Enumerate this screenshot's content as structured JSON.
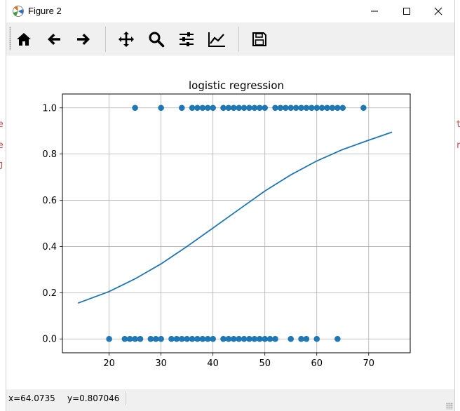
{
  "window": {
    "title": "Figure 2",
    "minimize_icon": "minimize-icon",
    "maximize_icon": "maximize-icon",
    "close_icon": "close-icon"
  },
  "toolbar": {
    "buttons": [
      {
        "name": "home-button",
        "icon": "home-icon"
      },
      {
        "name": "back-button",
        "icon": "arrow-left-icon"
      },
      {
        "name": "forward-button",
        "icon": "arrow-right-icon"
      },
      {
        "name": "pan-button",
        "icon": "move-icon"
      },
      {
        "name": "zoom-button",
        "icon": "magnifier-icon"
      },
      {
        "name": "subplots-button",
        "icon": "sliders-icon"
      },
      {
        "name": "edit-axes-button",
        "icon": "line-chart-icon"
      },
      {
        "name": "save-button",
        "icon": "floppy-disk-icon"
      }
    ]
  },
  "status": {
    "x_readout": "x=64.0735",
    "y_readout": "y=0.807046"
  },
  "colors": {
    "series": "#1f77b4",
    "grid": "#b0b0b0"
  },
  "chart_data": {
    "type": "scatter",
    "title": "logistic regression",
    "xlabel": "",
    "ylabel": "",
    "xlim": [
      11,
      78
    ],
    "ylim": [
      -0.06,
      1.06
    ],
    "xticks": [
      "20",
      "30",
      "40",
      "50",
      "60",
      "70"
    ],
    "xtick_values": [
      20,
      30,
      40,
      50,
      60,
      70
    ],
    "yticks": [
      "0.0",
      "0.2",
      "0.4",
      "0.6",
      "0.8",
      "1.0"
    ],
    "ytick_values": [
      0.0,
      0.2,
      0.4,
      0.6,
      0.8,
      1.0
    ],
    "grid": true,
    "series": [
      {
        "kind": "scatter",
        "x": [
          25,
          30,
          34,
          36,
          37,
          38,
          39,
          40,
          42,
          43,
          44,
          45,
          46,
          47,
          48,
          49,
          50,
          52,
          53,
          54,
          55,
          56,
          57,
          58,
          59,
          60,
          61,
          62,
          63,
          64,
          65,
          69,
          20,
          23,
          24,
          25,
          26,
          28,
          29,
          30,
          32,
          33,
          34,
          35,
          36,
          37,
          38,
          39,
          40,
          42,
          43,
          44,
          45,
          46,
          47,
          48,
          49,
          50,
          51,
          52,
          55,
          57,
          58,
          60,
          64
        ],
        "y": [
          1,
          1,
          1,
          1,
          1,
          1,
          1,
          1,
          1,
          1,
          1,
          1,
          1,
          1,
          1,
          1,
          1,
          1,
          1,
          1,
          1,
          1,
          1,
          1,
          1,
          1,
          1,
          1,
          1,
          1,
          1,
          1,
          0,
          0,
          0,
          0,
          0,
          0,
          0,
          0,
          0,
          0,
          0,
          0,
          0,
          0,
          0,
          0,
          0,
          0,
          0,
          0,
          0,
          0,
          0,
          0,
          0,
          0,
          0,
          0,
          0,
          0,
          0,
          0,
          0
        ]
      },
      {
        "kind": "line",
        "x": [
          14,
          20,
          25,
          30,
          35,
          40,
          45,
          50,
          55,
          60,
          65,
          70,
          74.5
        ],
        "y": [
          0.155,
          0.205,
          0.26,
          0.325,
          0.4,
          0.48,
          0.56,
          0.64,
          0.71,
          0.77,
          0.82,
          0.86,
          0.895
        ]
      }
    ]
  }
}
